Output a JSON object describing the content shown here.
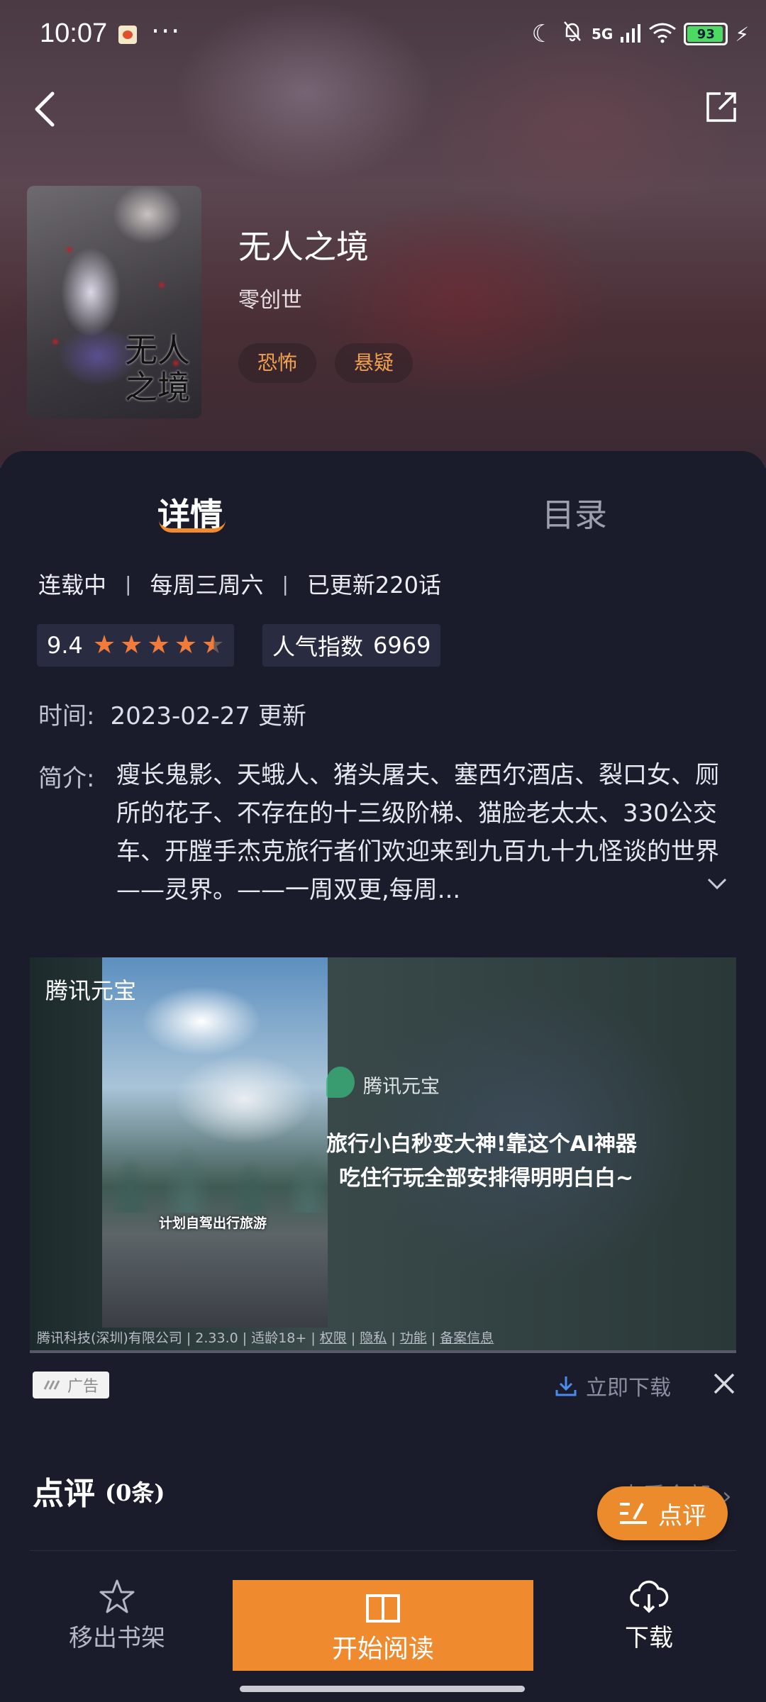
{
  "status_bar": {
    "time": "10:07",
    "dots": "···",
    "network": "5G",
    "battery": "93"
  },
  "book": {
    "title": "无人之境",
    "author": "零创世",
    "cover_text": "无人之境",
    "tags": [
      "恐怖",
      "悬疑"
    ]
  },
  "tabs": {
    "detail": "详情",
    "toc": "目录"
  },
  "meta": {
    "status": "连载中",
    "schedule": "每周三周六",
    "updated": "已更新220话"
  },
  "rating": {
    "score": "9.4",
    "stars": 4.5,
    "popularity_label": "人气指数",
    "popularity_value": "6969"
  },
  "time_row": {
    "label": "时间:",
    "value": "2023-02-27 更新"
  },
  "intro": {
    "label": "简介:",
    "text": "瘦长鬼影、天蛾人、猪头屠夫、塞西尔酒店、裂口女、厕所的花子、不存在的十三级阶梯、猫脸老太太、330公交车、开膛手杰克旅行者们欢迎来到九百九十九怪谈的世界——灵界。——一周双更,每周..."
  },
  "ad": {
    "brand": "腾讯元宝",
    "logo_text": "腾讯元宝",
    "headline1": "旅行小白秒变大神!靠这个AI神器",
    "headline2": "吃住行玩全部安排得明明白白~",
    "video_caption": "计划自驾出行旅游",
    "footer_company": "腾讯科技(深圳)有限公司 | 2.33.0 | 适龄18+ | ",
    "footer_links": [
      "权限",
      "隐私",
      "功能",
      "备案信息"
    ],
    "badge": "广告",
    "download": "立即下载"
  },
  "review": {
    "title": "点评",
    "count": "(0条)",
    "see_all": "查看全部",
    "fab": "点评"
  },
  "bottom_bar": {
    "shelf": "移出书架",
    "read": "开始阅读",
    "download": "下载"
  },
  "colors": {
    "accent": "#ef8a2f",
    "background": "#1b1c2b",
    "star": "#f07b3a",
    "tag_text": "#f0a050"
  }
}
